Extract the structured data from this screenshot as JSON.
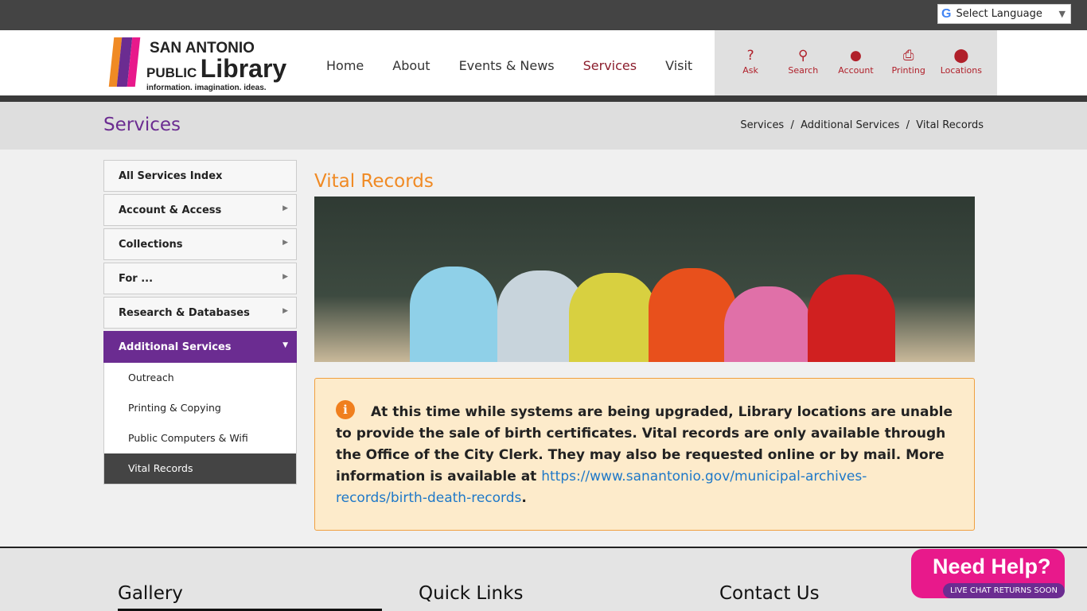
{
  "language": {
    "label": "Select Language",
    "arrow": "▼"
  },
  "logo": {
    "line1": "SAN ANTONIO",
    "line2a": "PUBLIC",
    "line2b": "Library",
    "tagline": "information. imagination. ideas."
  },
  "nav": [
    "Home",
    "About",
    "Events & News",
    "Services",
    "Visit"
  ],
  "tools": [
    {
      "label": "Ask",
      "icon": "?"
    },
    {
      "label": "Search",
      "icon": "⚲"
    },
    {
      "label": "Account",
      "icon": "●"
    },
    {
      "label": "Printing",
      "icon": "⎙"
    },
    {
      "label": "Locations",
      "icon": "⬤"
    }
  ],
  "page": {
    "title": "Services",
    "breadcrumb": [
      "Services",
      "Additional Services",
      "Vital Records"
    ]
  },
  "sidebar": {
    "items": [
      "All Services Index",
      "Account & Access",
      "Collections",
      "For ...",
      "Research & Databases",
      "Additional Services"
    ],
    "sub": [
      "Outreach",
      "Printing & Copying",
      "Public Computers & Wifi",
      "Vital Records"
    ]
  },
  "main": {
    "heading": "Vital Records",
    "notice": "At this time while systems are being upgraded, Library locations are unable to provide the sale of birth certificates. Vital records are only available through the Office of the City Clerk. They may also be requested online or by mail. More information is available at ",
    "link": "https://www.sanantonio.gov/municipal-archives-records/birth-death-records",
    "end": "."
  },
  "footer": {
    "cols": [
      "Gallery",
      "Quick Links",
      "Contact Us"
    ]
  },
  "help": {
    "title": "Need Help?",
    "pill": "LIVE CHAT RETURNS SOON"
  }
}
